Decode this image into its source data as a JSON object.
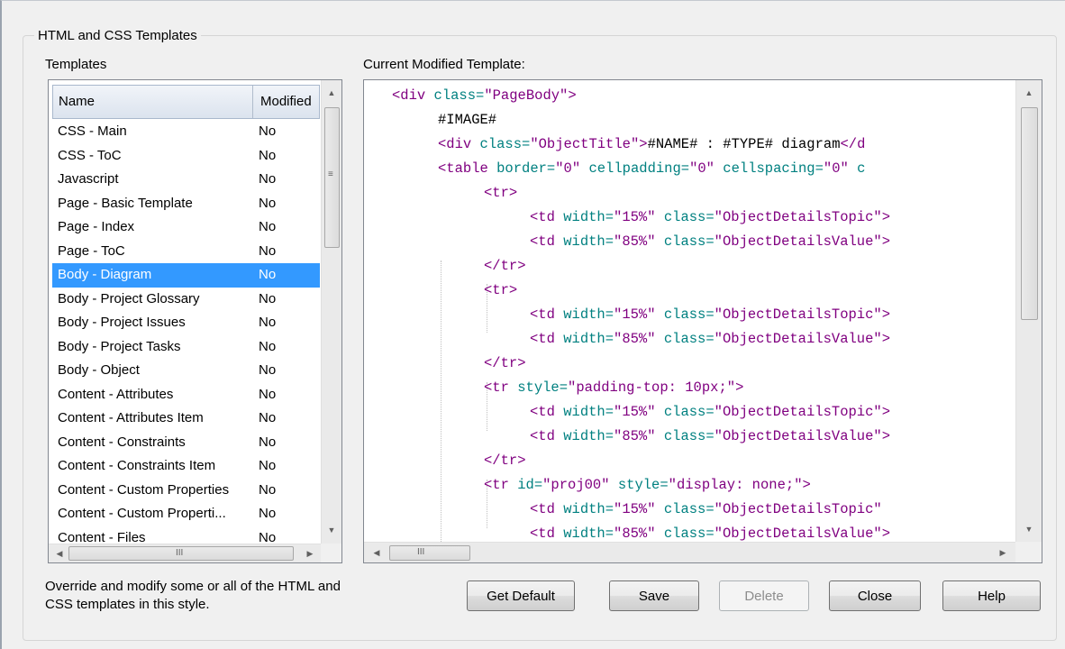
{
  "groupbox": {
    "title": "HTML and CSS Templates"
  },
  "templates": {
    "label": "Templates",
    "columns": {
      "name": "Name",
      "modified": "Modified"
    },
    "rows": [
      {
        "name": "CSS - Main",
        "modified": "No"
      },
      {
        "name": "CSS - ToC",
        "modified": "No"
      },
      {
        "name": "Javascript",
        "modified": "No"
      },
      {
        "name": "Page - Basic Template",
        "modified": "No"
      },
      {
        "name": "Page - Index",
        "modified": "No"
      },
      {
        "name": "Page - ToC",
        "modified": "No"
      },
      {
        "name": "Body - Diagram",
        "modified": "No",
        "selected": true
      },
      {
        "name": "Body - Project Glossary",
        "modified": "No"
      },
      {
        "name": "Body - Project Issues",
        "modified": "No"
      },
      {
        "name": "Body - Project Tasks",
        "modified": "No"
      },
      {
        "name": "Body - Object",
        "modified": "No"
      },
      {
        "name": "Content - Attributes",
        "modified": "No"
      },
      {
        "name": "Content - Attributes Item",
        "modified": "No"
      },
      {
        "name": "Content - Constraints",
        "modified": "No"
      },
      {
        "name": "Content - Constraints Item",
        "modified": "No"
      },
      {
        "name": "Content - Custom Properties",
        "modified": "No"
      },
      {
        "name": "Content - Custom Properti...",
        "modified": "No"
      },
      {
        "name": "Content - Files",
        "modified": "No"
      }
    ]
  },
  "editor": {
    "label": "Current Modified Template:",
    "lines": [
      {
        "indent": 0,
        "tokens": [
          [
            "tag",
            "<div "
          ],
          [
            "attr",
            "class="
          ],
          [
            "val",
            "\"PageBody\""
          ],
          [
            "tag",
            ">"
          ]
        ]
      },
      {
        "indent": 1,
        "tokens": [
          [
            "plain",
            "#IMAGE#"
          ]
        ]
      },
      {
        "indent": 1,
        "tokens": [
          [
            "tag",
            "<div "
          ],
          [
            "attr",
            "class="
          ],
          [
            "val",
            "\"ObjectTitle\""
          ],
          [
            "tag",
            ">"
          ],
          [
            "plain",
            "#NAME# : #TYPE# diagram"
          ],
          [
            "tag",
            "</d"
          ]
        ]
      },
      {
        "indent": 1,
        "tokens": [
          [
            "tag",
            "<table "
          ],
          [
            "attr",
            "border="
          ],
          [
            "val",
            "\"0\""
          ],
          [
            "attr",
            " cellpadding="
          ],
          [
            "val",
            "\"0\""
          ],
          [
            "attr",
            " cellspacing="
          ],
          [
            "val",
            "\"0\""
          ],
          [
            "attr",
            " c"
          ]
        ]
      },
      {
        "indent": 2,
        "tokens": [
          [
            "tag",
            "<tr>"
          ]
        ]
      },
      {
        "indent": 3,
        "tokens": [
          [
            "tag",
            "<td "
          ],
          [
            "attr",
            "width="
          ],
          [
            "val",
            "\"15%\""
          ],
          [
            "attr",
            " class="
          ],
          [
            "val",
            "\"ObjectDetailsTopic\""
          ],
          [
            "tag",
            ">"
          ]
        ]
      },
      {
        "indent": 3,
        "tokens": [
          [
            "tag",
            "<td "
          ],
          [
            "attr",
            "width="
          ],
          [
            "val",
            "\"85%\""
          ],
          [
            "attr",
            " class="
          ],
          [
            "val",
            "\"ObjectDetailsValue\""
          ],
          [
            "tag",
            ">"
          ]
        ]
      },
      {
        "indent": 2,
        "tokens": [
          [
            "tag",
            "</tr>"
          ]
        ]
      },
      {
        "indent": 2,
        "tokens": [
          [
            "tag",
            "<tr>"
          ]
        ]
      },
      {
        "indent": 3,
        "tokens": [
          [
            "tag",
            "<td "
          ],
          [
            "attr",
            "width="
          ],
          [
            "val",
            "\"15%\""
          ],
          [
            "attr",
            " class="
          ],
          [
            "val",
            "\"ObjectDetailsTopic\""
          ],
          [
            "tag",
            ">"
          ]
        ]
      },
      {
        "indent": 3,
        "tokens": [
          [
            "tag",
            "<td "
          ],
          [
            "attr",
            "width="
          ],
          [
            "val",
            "\"85%\""
          ],
          [
            "attr",
            " class="
          ],
          [
            "val",
            "\"ObjectDetailsValue\""
          ],
          [
            "tag",
            ">"
          ]
        ]
      },
      {
        "indent": 2,
        "tokens": [
          [
            "tag",
            "</tr>"
          ]
        ]
      },
      {
        "indent": 2,
        "tokens": [
          [
            "tag",
            "<tr "
          ],
          [
            "attr",
            "style="
          ],
          [
            "val",
            "\"padding-top: 10px;\""
          ],
          [
            "tag",
            ">"
          ]
        ]
      },
      {
        "indent": 3,
        "tokens": [
          [
            "tag",
            "<td "
          ],
          [
            "attr",
            "width="
          ],
          [
            "val",
            "\"15%\""
          ],
          [
            "attr",
            " class="
          ],
          [
            "val",
            "\"ObjectDetailsTopic\""
          ],
          [
            "tag",
            ">"
          ]
        ]
      },
      {
        "indent": 3,
        "tokens": [
          [
            "tag",
            "<td "
          ],
          [
            "attr",
            "width="
          ],
          [
            "val",
            "\"85%\""
          ],
          [
            "attr",
            " class="
          ],
          [
            "val",
            "\"ObjectDetailsValue\""
          ],
          [
            "tag",
            ">"
          ]
        ]
      },
      {
        "indent": 2,
        "tokens": [
          [
            "tag",
            "</tr>"
          ]
        ]
      },
      {
        "indent": 2,
        "tokens": [
          [
            "tag",
            "<tr "
          ],
          [
            "attr",
            "id="
          ],
          [
            "val",
            "\"proj00\""
          ],
          [
            "attr",
            " style="
          ],
          [
            "val",
            "\"display: none;\""
          ],
          [
            "tag",
            ">"
          ]
        ]
      },
      {
        "indent": 3,
        "tokens": [
          [
            "tag",
            "<td "
          ],
          [
            "attr",
            "width="
          ],
          [
            "val",
            "\"15%\""
          ],
          [
            "attr",
            " class="
          ],
          [
            "val",
            "\"ObjectDetailsTopic\""
          ]
        ]
      },
      {
        "indent": 3,
        "tokens": [
          [
            "tag",
            "<td "
          ],
          [
            "attr",
            "width="
          ],
          [
            "val",
            "\"85%\""
          ],
          [
            "attr",
            " class="
          ],
          [
            "val",
            "\"ObjectDetailsValue\""
          ],
          [
            "tag",
            ">"
          ]
        ]
      }
    ]
  },
  "description": "Override and modify some or all of the HTML and CSS templates in this style.",
  "buttons": {
    "get_default": "Get Default",
    "save": "Save",
    "delete": "Delete",
    "close": "Close",
    "help": "Help"
  },
  "scrollbar_glyphs": {
    "up": "▲",
    "down": "▼",
    "left": "◀",
    "right": "▶",
    "grip_v": "≡",
    "grip_h": "III"
  },
  "colors": {
    "selection": "#3399ff",
    "tag": "#800080",
    "attribute": "#008080"
  }
}
